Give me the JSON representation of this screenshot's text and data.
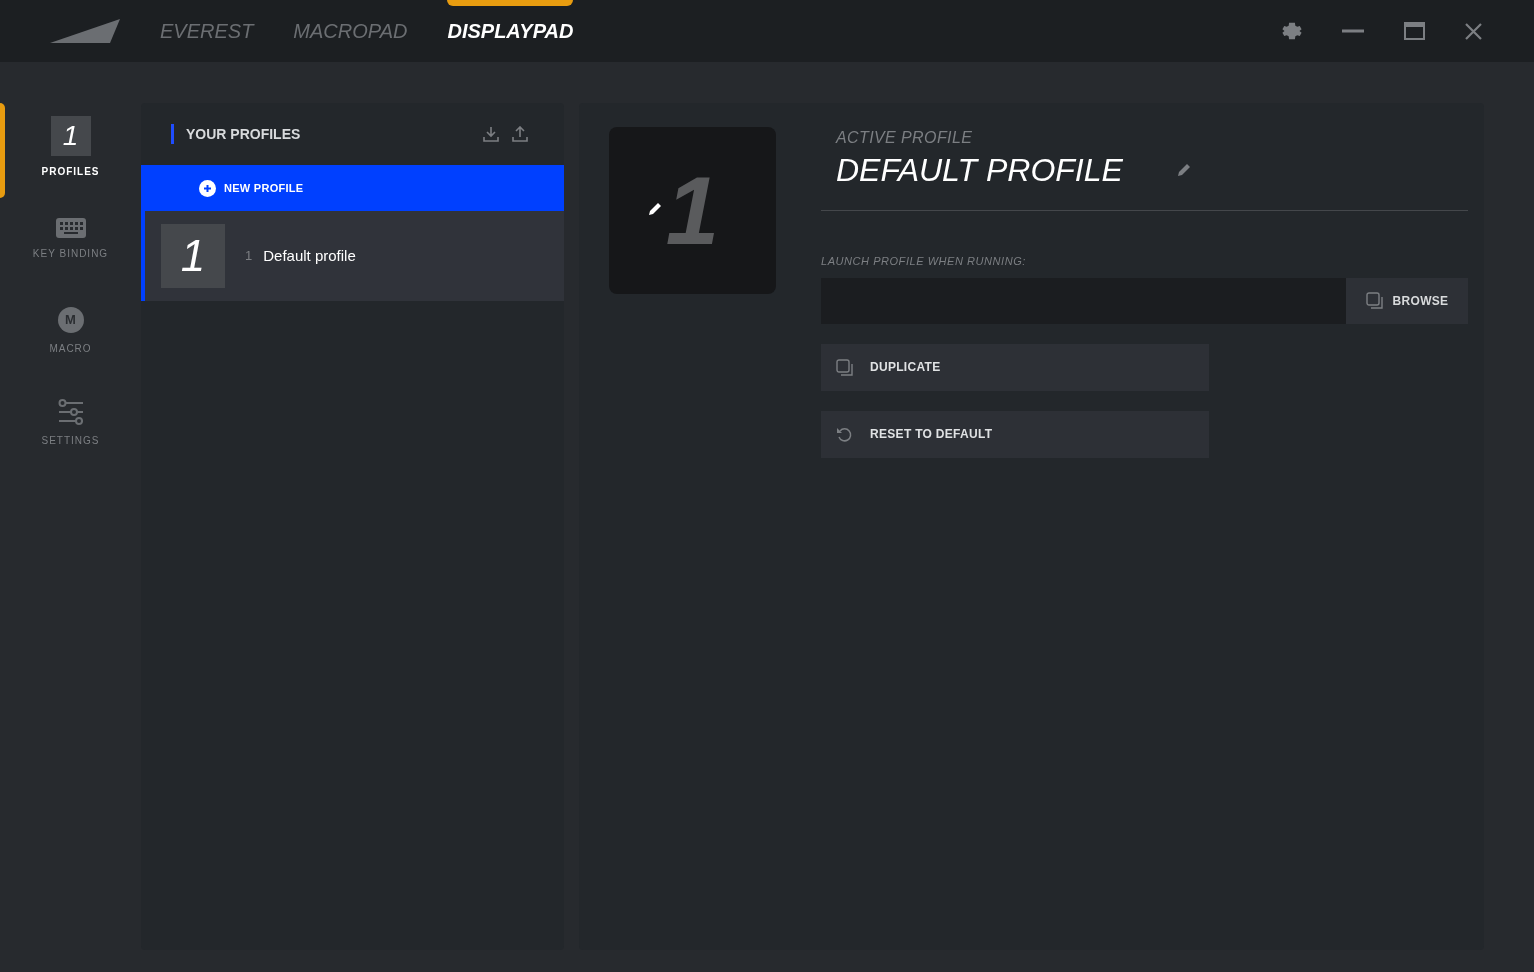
{
  "top_tabs": [
    {
      "label": "EVEREST",
      "selected": false
    },
    {
      "label": "MACROPAD",
      "selected": false
    },
    {
      "label": "DISPLAYPAD",
      "selected": true
    }
  ],
  "nav": [
    {
      "kind": "tile",
      "glyph": "1",
      "label": "PROFILES",
      "selected": true
    },
    {
      "kind": "keyboard",
      "label": "KEY BINDING",
      "selected": false
    },
    {
      "kind": "badge",
      "glyph": "M",
      "label": "MACRO",
      "selected": false
    },
    {
      "kind": "sliders",
      "label": "SETTINGS",
      "selected": false
    }
  ],
  "profiles_panel": {
    "title": "YOUR PROFILES",
    "new_button": "NEW PROFILE",
    "items": [
      {
        "tile": "1",
        "number": "1",
        "name": "Default profile",
        "selected": true
      }
    ]
  },
  "active": {
    "tile": "1",
    "caption": "ACTIVE PROFILE",
    "name": "DEFAULT PROFILE",
    "launch_label": "LAUNCH PROFILE WHEN RUNNING:",
    "browse": "BROWSE",
    "actions": [
      {
        "kind": "duplicate",
        "label": "DUPLICATE"
      },
      {
        "kind": "reset",
        "label": "RESET TO DEFAULT"
      }
    ]
  }
}
